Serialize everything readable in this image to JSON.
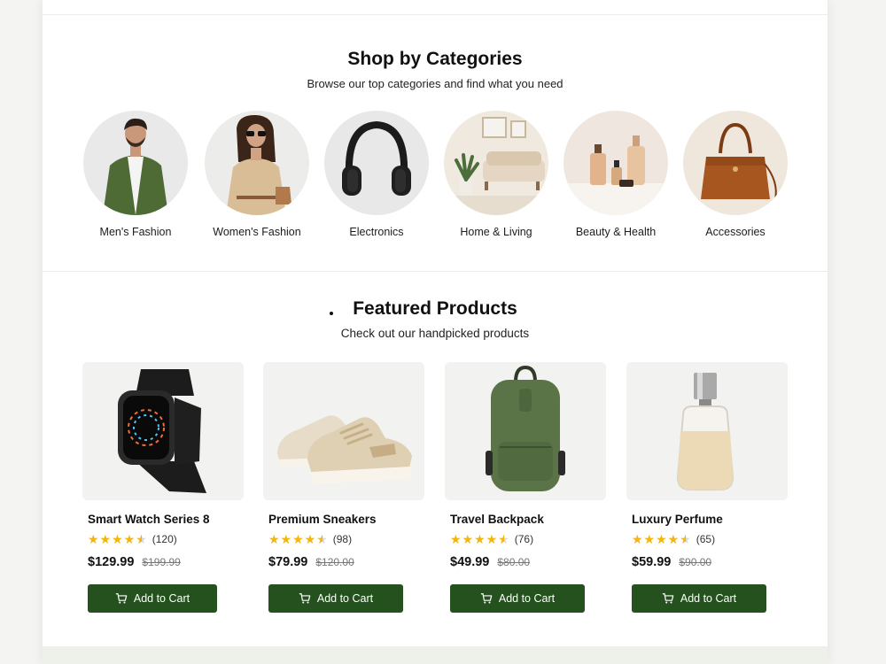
{
  "categories": {
    "title": "Shop by Categories",
    "subtitle": "Browse our top categories and find what you need",
    "items": [
      {
        "label": "Men's Fashion"
      },
      {
        "label": "Women's Fashion"
      },
      {
        "label": "Electronics"
      },
      {
        "label": "Home & Living"
      },
      {
        "label": "Beauty & Health"
      },
      {
        "label": "Accessories"
      }
    ]
  },
  "featured": {
    "title": "Featured Products",
    "subtitle": "Check out our handpicked products",
    "cart_label": "Add to Cart",
    "products": [
      {
        "name": "Smart Watch Series 8",
        "rating": 4.5,
        "reviews": "(120)",
        "price": "$129.99",
        "old_price": "$199.99"
      },
      {
        "name": "Premium Sneakers",
        "rating": 4.5,
        "reviews": "(98)",
        "price": "$79.99",
        "old_price": "$120.00"
      },
      {
        "name": "Travel Backpack",
        "rating": 4.5,
        "reviews": "(76)",
        "price": "$49.99",
        "old_price": "$80.00"
      },
      {
        "name": "Luxury Perfume",
        "rating": 4.5,
        "reviews": "(65)",
        "price": "$59.99",
        "old_price": "$90.00"
      }
    ]
  },
  "colors": {
    "accent_green": "#24511e",
    "star": "#f5b50a"
  }
}
